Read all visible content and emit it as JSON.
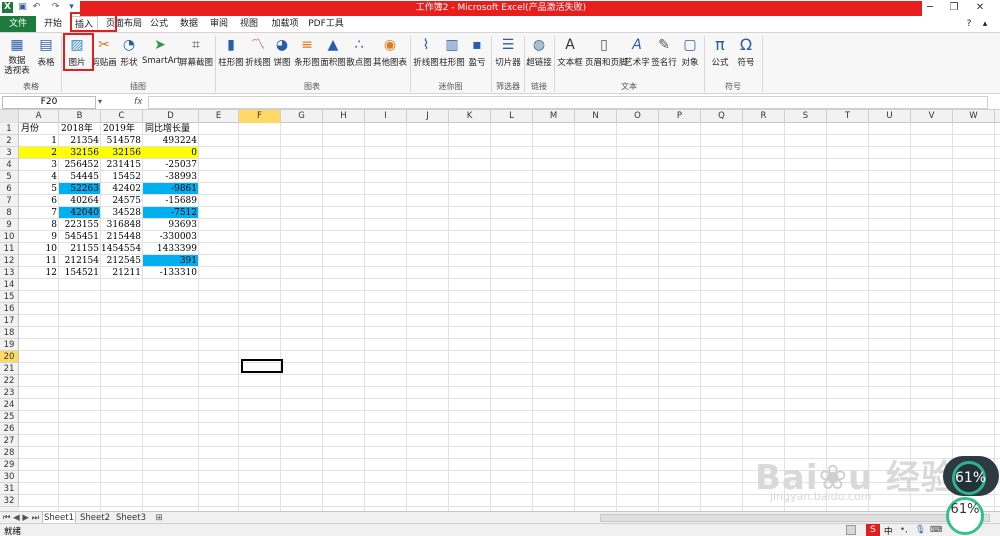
{
  "title": "工作簿2 - Microsoft Excel(产品激活失败)",
  "tabs": [
    "文件",
    "开始",
    "插入",
    "页面布局",
    "公式",
    "数据",
    "审阅",
    "视图",
    "加载项",
    "PDF工具"
  ],
  "ribbon": {
    "buttons": [
      "数据\n透视表",
      "表格",
      "图片",
      "剪贴画",
      "形状",
      "SmartArt",
      "屏幕截图",
      "柱形图",
      "折线图",
      "饼图",
      "条形图",
      "面积图",
      "散点图",
      "其他图表",
      "折线图",
      "柱形图",
      "盈亏",
      "切片器",
      "超链接",
      "文本框",
      "页眉和页脚",
      "艺术字",
      "签名行",
      "对象",
      "公式",
      "符号"
    ],
    "groups": [
      "表格",
      "插图",
      "图表",
      "迷你图",
      "筛选器",
      "链接",
      "文本",
      "符号"
    ]
  },
  "namebox": "F20",
  "fx": "fx",
  "columns": [
    "A",
    "B",
    "C",
    "D",
    "E",
    "F",
    "G",
    "H",
    "I",
    "J",
    "K",
    "L",
    "M",
    "N",
    "O",
    "P",
    "Q",
    "R",
    "S",
    "T",
    "U",
    "V",
    "W"
  ],
  "rows": [
    "1",
    "2",
    "3",
    "4",
    "5",
    "6",
    "7",
    "8",
    "9",
    "10",
    "11",
    "12",
    "13",
    "14",
    "15",
    "16",
    "17",
    "18",
    "19",
    "20",
    "21",
    "22",
    "23",
    "24",
    "25",
    "26",
    "27",
    "28",
    "29",
    "30",
    "31",
    "32"
  ],
  "table": {
    "headers": [
      "月份",
      "2018年",
      "2019年",
      "同比增长量"
    ],
    "rows": [
      [
        "1",
        "21354",
        "514578",
        "493224"
      ],
      [
        "2",
        "32156",
        "32156",
        "0"
      ],
      [
        "3",
        "256452",
        "231415",
        "-25037"
      ],
      [
        "4",
        "54445",
        "15452",
        "-38993"
      ],
      [
        "5",
        "52263",
        "42402",
        "-9861"
      ],
      [
        "6",
        "40264",
        "24575",
        "-15689"
      ],
      [
        "7",
        "42040",
        "34528",
        "-7512"
      ],
      [
        "8",
        "223155",
        "316848",
        "93693"
      ],
      [
        "9",
        "545451",
        "215448",
        "-330003"
      ],
      [
        "10",
        "21155",
        "1454554",
        "1433399"
      ],
      [
        "11",
        "212154",
        "212545",
        "391"
      ],
      [
        "12",
        "154521",
        "21211",
        "-133310"
      ]
    ]
  },
  "sheets": [
    "Sheet1",
    "Sheet2",
    "Sheet3"
  ],
  "status": "就绪",
  "colors": {
    "yellow": "#ffff00",
    "blue": "#00b0f0",
    "red": "#e81e1e",
    "green": "#1f7a3e"
  },
  "watermark": {
    "logo": "Baidu 经验",
    "url": "jingyan.baidu.com"
  },
  "badge": {
    "value1": "61%",
    "value2": "61%"
  }
}
